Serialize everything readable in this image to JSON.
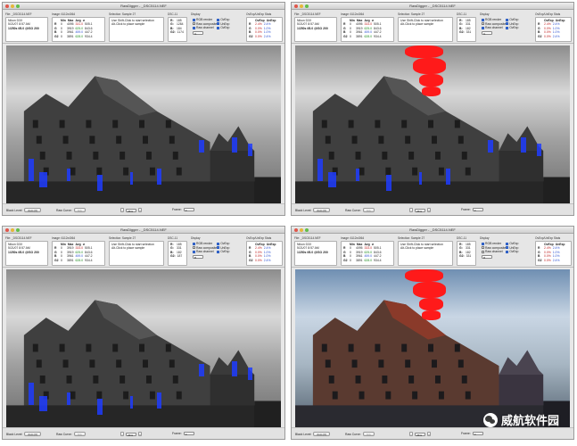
{
  "watermark": {
    "text": "威航软件园",
    "icon": "wechat-icon"
  },
  "windows": [
    {
      "title": "RawDigger - _DSC5114.NEF",
      "mode": "grey",
      "file_label": "File: _DSC5114.NEF",
      "camera": [
        "Nikon D3X",
        "5/21/07 8:57 AM",
        "1/250s f/8.0 @ISO 200"
      ],
      "image_label": "Image: 6112x4064",
      "image_header": [
        "",
        "Min",
        "Max",
        "Avg",
        "σ"
      ],
      "image_rows": [
        [
          "R",
          "0",
          "4095",
          "331.0",
          "505.1"
        ],
        [
          "G",
          "0",
          "3919",
          "625.0",
          "843.6"
        ],
        [
          "B",
          "0",
          "3961",
          "459.0",
          "447.2"
        ],
        [
          "G2",
          "0",
          "3891",
          "628.0",
          "934.4"
        ]
      ],
      "selection_label": "Selection: Sample 27",
      "selection_text": [
        "Use Shift-Click to start selection",
        "Alt-Click to place sample"
      ],
      "sample_label": "DSC-11",
      "sample_rows": [
        [
          "R:",
          "185"
        ],
        [
          "G:",
          "1284"
        ],
        [
          "B:",
          "184"
        ],
        [
          "G2:",
          "1174"
        ]
      ],
      "display_label": "Display",
      "display_opts": [
        [
          "RGB render",
          true
        ],
        [
          "Raw composite",
          false
        ],
        [
          "Raw channel",
          true
        ]
      ],
      "display_right": [
        [
          "OvExp",
          true
        ],
        [
          "UnExp",
          true
        ],
        [
          "OvExp",
          true
        ]
      ],
      "channel_select": "G",
      "stats_label": "OvExp/UnExp Stats",
      "stats_header": [
        "",
        "OvExp",
        "UnExp"
      ],
      "stats_rows": [
        [
          "R",
          "2.4%",
          "2.4%"
        ],
        [
          "G",
          "0.0%",
          "1.0%"
        ],
        [
          "B",
          "0.0%",
          "1.0%"
        ],
        [
          "G2",
          "0.0%",
          "2.4%"
        ]
      ],
      "black_level_label": "Black Level:",
      "black_level_value": "Auto (0)",
      "raw_curve_label": "Raw Curve:",
      "raw_curve_value": "N/A",
      "zoom": "25%",
      "frame_label": "Frame:",
      "frame_value": "0",
      "clip": "blue"
    },
    {
      "title": "RawDigger - _DSC5114.NEF",
      "mode": "grey",
      "file_label": "File: _DSC5114.NEF",
      "camera": [
        "Nikon D3X",
        "5/21/07 8:57 AM",
        "1/250s f/8.0 @ISO 200"
      ],
      "image_label": "Image: 6112x4064",
      "image_header": [
        "",
        "Min",
        "Max",
        "Avg",
        "σ"
      ],
      "image_rows": [
        [
          "R",
          "0",
          "4095",
          "333.0",
          "505.1"
        ],
        [
          "G",
          "0",
          "3919",
          "625.0",
          "843.6"
        ],
        [
          "B",
          "0",
          "3961",
          "459.0",
          "447.2"
        ],
        [
          "G2",
          "0",
          "3891",
          "628.0",
          "934.4"
        ]
      ],
      "selection_label": "Selection: Sample 27",
      "selection_text": [
        "Use Shift-Click to start selection",
        "Alt-Click to place sample"
      ],
      "sample_label": "DSC-11",
      "sample_rows": [
        [
          "R:",
          "185"
        ],
        [
          "G:",
          "331"
        ],
        [
          "B:",
          "182"
        ],
        [
          "G2:",
          "331"
        ]
      ],
      "display_label": "Display",
      "display_opts": [
        [
          "RGB render",
          true
        ],
        [
          "Raw composite",
          false
        ],
        [
          "Raw channel",
          true
        ]
      ],
      "display_right": [
        [
          "OvExp",
          true
        ],
        [
          "UnExp",
          true
        ],
        [
          "OvExp",
          true
        ]
      ],
      "channel_select": "G",
      "stats_label": "OvExp/UnExp Stats",
      "stats_header": [
        "",
        "OvExp",
        "UnExp"
      ],
      "stats_rows": [
        [
          "R",
          "2.4%",
          "2.4%"
        ],
        [
          "G",
          "0.0%",
          "1.0%"
        ],
        [
          "B",
          "0.0%",
          "1.0%"
        ],
        [
          "G2",
          "0.0%",
          "2.4%"
        ]
      ],
      "black_level_label": "Black Level:",
      "black_level_value": "Auto (0)",
      "raw_curve_label": "Raw Curve:",
      "raw_curve_value": "N/A",
      "zoom": "25%",
      "frame_label": "Frame:",
      "frame_value": "0",
      "clip": "red"
    },
    {
      "title": "RawDigger - _DSC5114.NEF",
      "mode": "grey",
      "file_label": "File: _DSC5114.NEF",
      "camera": [
        "Nikon D3X",
        "5/21/07 8:57 AM",
        "1/250s f/8.0 @ISO 200"
      ],
      "image_label": "Image: 6112x4064",
      "image_header": [
        "",
        "Min",
        "Max",
        "Avg",
        "σ"
      ],
      "image_rows": [
        [
          "R",
          "0",
          "3919",
          "333.0",
          "505.1"
        ],
        [
          "G",
          "0",
          "3919",
          "625.0",
          "843.6"
        ],
        [
          "B",
          "0",
          "3961",
          "459.0",
          "447.2"
        ],
        [
          "G2",
          "0",
          "3891",
          "628.0",
          "934.4"
        ]
      ],
      "selection_label": "Selection: Sample 27",
      "selection_text": [
        "Use Shift-Click to start selection",
        "Alt-Click to place sample"
      ],
      "sample_label": "DSC-11",
      "sample_rows": [
        [
          "R:",
          "185"
        ],
        [
          "G:",
          "331"
        ],
        [
          "B:",
          "182"
        ],
        [
          "G2:",
          "187"
        ]
      ],
      "display_label": "Display",
      "display_opts": [
        [
          "RGB render",
          true
        ],
        [
          "Raw composite",
          false
        ],
        [
          "Raw channel",
          true
        ]
      ],
      "display_right": [
        [
          "OvExp",
          true
        ],
        [
          "UnExp",
          true
        ],
        [
          "OvExp",
          true
        ]
      ],
      "channel_select": "B",
      "stats_label": "OvExp/UnExp Stats",
      "stats_header": [
        "",
        "OvExp",
        "UnExp"
      ],
      "stats_rows": [
        [
          "R",
          "2.4%",
          "2.4%"
        ],
        [
          "G",
          "0.0%",
          "1.0%"
        ],
        [
          "B",
          "0.0%",
          "1.0%"
        ],
        [
          "G2",
          "0.0%",
          "2.4%"
        ]
      ],
      "black_level_label": "Black Level:",
      "black_level_value": "Auto (0)",
      "raw_curve_label": "Raw Curve:",
      "raw_curve_value": "N/A",
      "zoom": "25%",
      "frame_label": "Frame:",
      "frame_value": "0",
      "clip": "blue"
    },
    {
      "title": "RawDigger - _DSC5114.NEF",
      "mode": "color",
      "file_label": "File: _DSC5114.NEF",
      "camera": [
        "Nikon D3X",
        "5/21/07 8:57 AM",
        "1/250s f/8.0 @ISO 200"
      ],
      "image_label": "Image: 6112x4064",
      "image_header": [
        "",
        "Min",
        "Max",
        "Avg",
        "σ"
      ],
      "image_rows": [
        [
          "R",
          "0",
          "4095",
          "333.0",
          "505.1"
        ],
        [
          "G",
          "0",
          "3919",
          "625.0",
          "843.6"
        ],
        [
          "B",
          "0",
          "3961",
          "459.0",
          "447.2"
        ],
        [
          "G2",
          "0",
          "3891",
          "628.0",
          "934.4"
        ]
      ],
      "selection_label": "Selection: Sample 27",
      "selection_text": [
        "Use Shift-Click to start selection",
        "Alt-Click to place sample"
      ],
      "sample_label": "DSC-11",
      "sample_rows": [
        [
          "R:",
          "185"
        ],
        [
          "G:",
          "331"
        ],
        [
          "B:",
          "182"
        ],
        [
          "G2:",
          "331"
        ]
      ],
      "display_label": "Display",
      "display_opts": [
        [
          "RGB render",
          true
        ],
        [
          "Raw composite",
          false
        ],
        [
          "Raw channel",
          false
        ]
      ],
      "display_right": [
        [
          "OvExp",
          true
        ],
        [
          "UnExp",
          true
        ],
        [
          "OvExp",
          true
        ]
      ],
      "channel_select": "R",
      "stats_label": "OvExp/UnExp Stats",
      "stats_header": [
        "",
        "OvExp",
        "UnExp"
      ],
      "stats_rows": [
        [
          "R",
          "2.4%",
          "2.4%"
        ],
        [
          "G",
          "0.0%",
          "1.0%"
        ],
        [
          "B",
          "0.0%",
          "1.0%"
        ],
        [
          "G2",
          "0.0%",
          "2.4%"
        ]
      ],
      "black_level_label": "Black Level:",
      "black_level_value": "Auto (0)",
      "raw_curve_label": "Raw Curve:",
      "raw_curve_value": "N/A",
      "zoom": "25%",
      "frame_label": "Frame:",
      "frame_value": "0",
      "clip": "red"
    }
  ]
}
